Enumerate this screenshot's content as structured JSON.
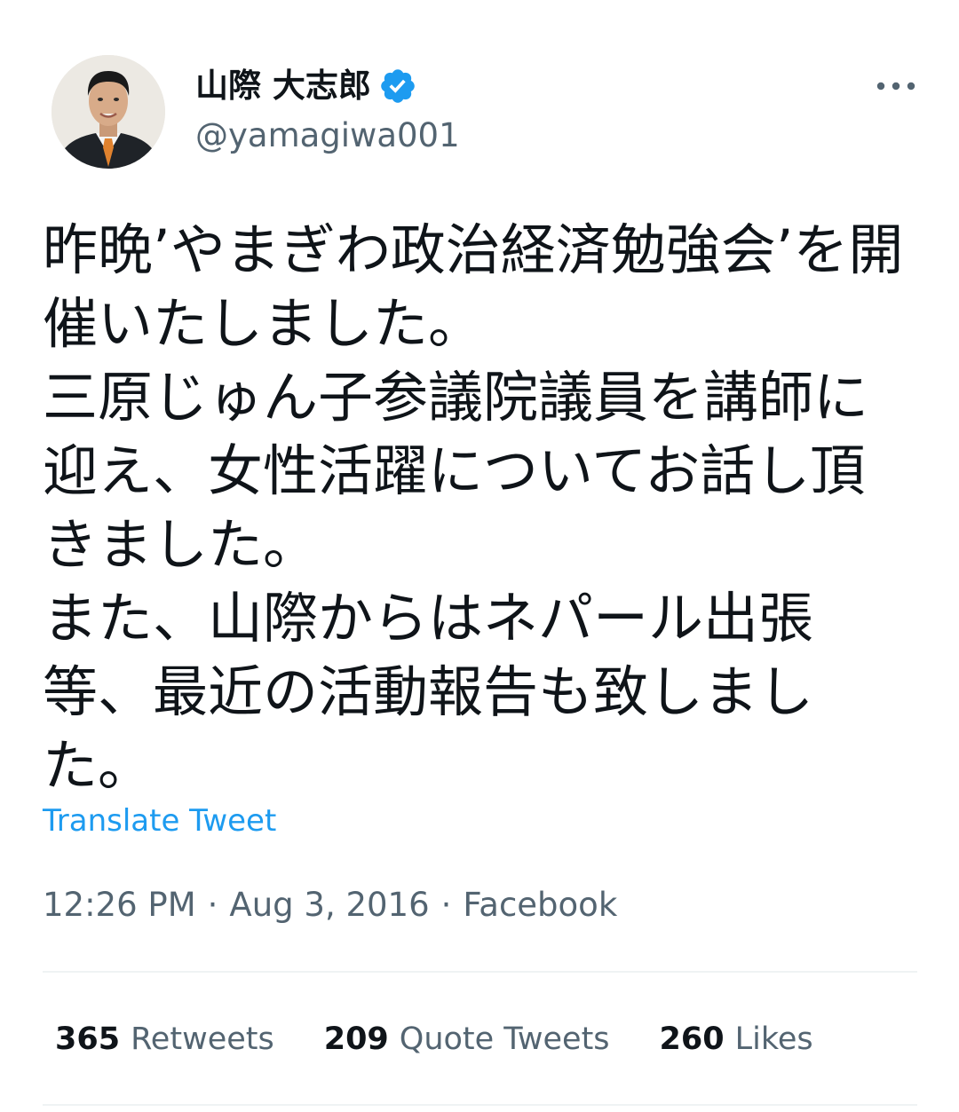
{
  "author": {
    "display_name": "山際 大志郎",
    "handle": "@yamagiwa001",
    "verified": true,
    "avatar_icon": "profile-photo",
    "verified_icon": "verified-badge-icon"
  },
  "more_icon": "more-options-icon",
  "tweet": {
    "text": "昨晩’やまぎわ政治経済勉強会’を開催いたしました。\n三原じゅん子参議院議員を講師に迎え、女性活躍についてお話し頂きました。\nまた、山際からはネパール出張等、最近の活動報告も致しました。",
    "translate_label": "Translate Tweet"
  },
  "meta": {
    "time": "12:26 PM",
    "separator": "·",
    "date": "Aug 3, 2016",
    "source": "Facebook"
  },
  "stats": [
    {
      "count": "365",
      "label": "Retweets"
    },
    {
      "count": "209",
      "label": "Quote Tweets"
    },
    {
      "count": "260",
      "label": "Likes"
    }
  ],
  "colors": {
    "text_primary": "#0f1419",
    "text_secondary": "#536471",
    "accent": "#1d9bf0",
    "divider": "#eff3f4"
  }
}
